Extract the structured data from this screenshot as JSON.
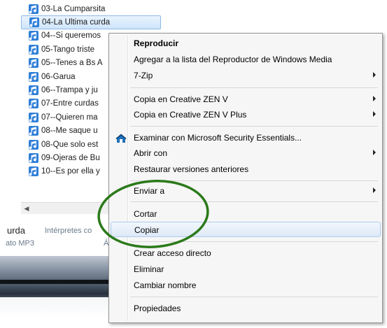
{
  "file_list": {
    "items": [
      {
        "label": "03-La Cumparsita"
      },
      {
        "label": "04-La Ultima curda"
      },
      {
        "label": "04--Si queremos"
      },
      {
        "label": "05-Tango triste"
      },
      {
        "label": "05--Tenes a Bs A"
      },
      {
        "label": "06-Garua"
      },
      {
        "label": "06--Trampa y ju"
      },
      {
        "label": "07-Entre curdas"
      },
      {
        "label": "07--Quieren ma"
      },
      {
        "label": "08--Me saque u"
      },
      {
        "label": "08-Que solo est"
      },
      {
        "label": "09-Ojeras de Bu"
      },
      {
        "label": "10--Es por ella y"
      }
    ],
    "selected_index": 1,
    "icon": "music-note-icon"
  },
  "details_pane": {
    "name": "urda",
    "interpretes_label": "Intérpretes co",
    "type": "ato MP3",
    "extra": "Á"
  },
  "context_menu": {
    "items": [
      {
        "label": "Reproducir",
        "bold": true
      },
      {
        "label": "Agregar a la lista del Reproductor de Windows Media"
      },
      {
        "label": "7-Zip",
        "submenu": true
      },
      {
        "label": "Copia en Creative ZEN V",
        "submenu": true
      },
      {
        "label": "Copia en Creative ZEN V Plus",
        "submenu": true
      },
      {
        "label": "Examinar con Microsoft Security Essentials...",
        "icon": "security-essentials-icon"
      },
      {
        "label": "Abrir con",
        "submenu": true
      },
      {
        "label": "Restaurar versiones anteriores"
      },
      {
        "label": "Enviar a",
        "submenu": true
      },
      {
        "label": "Cortar"
      },
      {
        "label": "Copiar",
        "highlighted": true
      },
      {
        "label": "Crear acceso directo"
      },
      {
        "label": "Eliminar"
      },
      {
        "label": "Cambiar nombre"
      },
      {
        "label": "Propiedades"
      }
    ]
  },
  "annotation": {
    "color": "#2b7a1a",
    "shape": "ellipse"
  },
  "colors": {
    "selection": "#cfe5fb",
    "menu_background": "#f6f6f6",
    "highlight_border": "#aecaf0"
  }
}
